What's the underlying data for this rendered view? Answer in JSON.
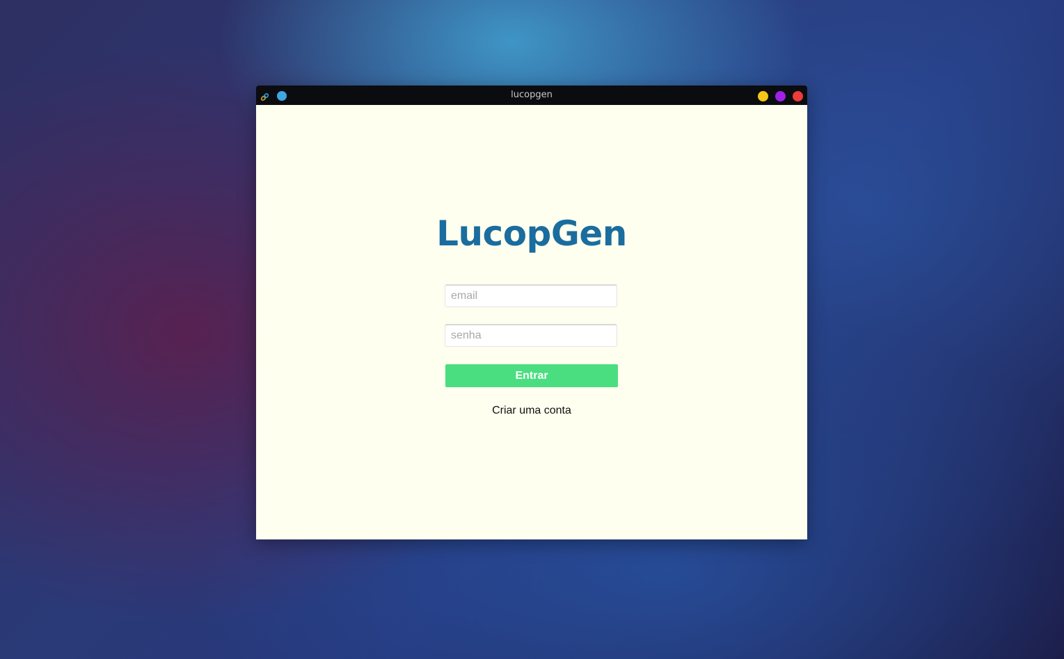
{
  "window": {
    "title": "lucopgen",
    "controls": {
      "minimize_color": "#f5c518",
      "maximize_color": "#a020e8",
      "close_color": "#ee3b3b"
    }
  },
  "app": {
    "brand": "LucopGen",
    "brand_color": "#1a6d9e",
    "background_color": "#fffff0"
  },
  "login_form": {
    "email_placeholder": "email",
    "email_value": "",
    "password_placeholder": "senha",
    "password_value": "",
    "submit_label": "Entrar",
    "submit_color": "#4ade80",
    "create_account_label": "Criar uma conta"
  },
  "icons": {
    "app_icon": "link-icon",
    "pin_dot": "blue-dot-icon"
  }
}
